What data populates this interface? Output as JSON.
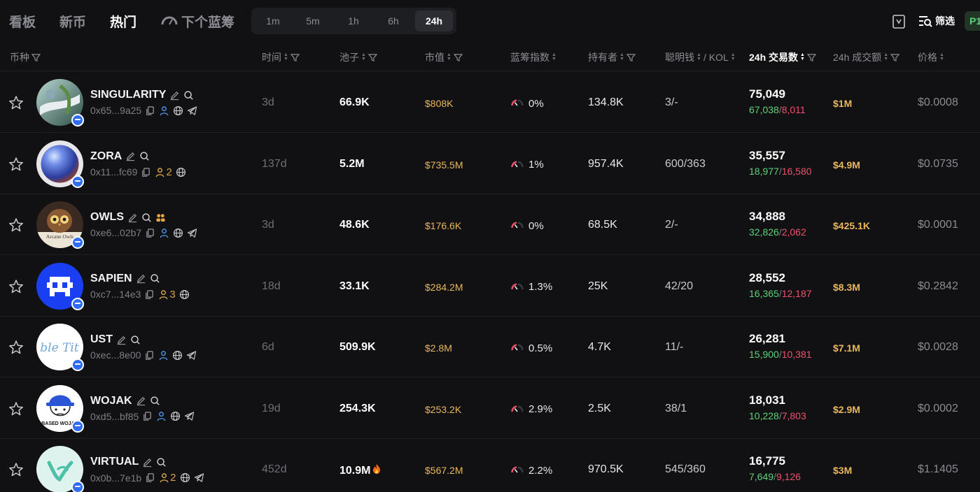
{
  "nav": {
    "tabs": [
      "看板",
      "新币",
      "热门",
      "下个蓝筹"
    ],
    "active_tab": "热门",
    "timeframes": [
      "1m",
      "5m",
      "1h",
      "6h",
      "24h"
    ],
    "active_timeframe": "24h",
    "filter_label": "筛选",
    "page_badge": "P1"
  },
  "headers": {
    "token": "币种",
    "time": "时间",
    "pool": "池子",
    "mcap": "市值",
    "bluechip": "蓝筹指数",
    "holders": "持有者",
    "smart": "聪明钱",
    "kol": "/ KOL",
    "tx": "24h 交易数",
    "volume": "24h 成交额",
    "price": "价格"
  },
  "colors": {
    "buy": "#5fd27a",
    "sell": "#f0506e",
    "accent": "#e9b75c"
  },
  "rows": [
    {
      "name": "SINGULARITY",
      "address": "0x65...9a25",
      "holder_badge": "",
      "icons": [
        "copy-icon",
        "user-icon",
        "globe-icon",
        "telegram-icon"
      ],
      "time": "3d",
      "pool": "66.9K",
      "fire": false,
      "mcap": "$808K",
      "bluechip": "0%",
      "holders": "134.8K",
      "smart": "3/-",
      "tx": "75,049",
      "buys": "67,038",
      "sells": "8,011",
      "volume": "$1M",
      "price": "$0.0008",
      "avatar": "singularity"
    },
    {
      "name": "ZORA",
      "address": "0x11...fc69",
      "holder_badge": "2",
      "icons": [
        "copy-icon",
        "users-icon",
        "globe-icon"
      ],
      "time": "137d",
      "pool": "5.2M",
      "fire": false,
      "mcap": "$735.5M",
      "bluechip": "1%",
      "holders": "957.4K",
      "smart": "600/363",
      "tx": "35,557",
      "buys": "18,977",
      "sells": "16,580",
      "volume": "$4.9M",
      "price": "$0.0735",
      "avatar": "zora"
    },
    {
      "name": "OWLS",
      "address": "0xe6...02b7",
      "holder_badge": "",
      "icons": [
        "copy-icon",
        "user-icon",
        "globe-icon",
        "telegram-icon"
      ],
      "time": "3d",
      "pool": "48.6K",
      "fire": false,
      "mcap": "$176.6K",
      "bluechip": "0%",
      "holders": "68.5K",
      "smart": "2/-",
      "tx": "34,888",
      "buys": "32,826",
      "sells": "2,062",
      "volume": "$425.1K",
      "price": "$0.0001",
      "avatar": "owls",
      "avatar_text": "Arcane Owls"
    },
    {
      "name": "SAPIEN",
      "address": "0xc7...14e3",
      "holder_badge": "3",
      "icons": [
        "copy-icon",
        "users-icon",
        "globe-icon"
      ],
      "time": "18d",
      "pool": "33.1K",
      "fire": false,
      "mcap": "$284.2M",
      "bluechip": "1.3%",
      "holders": "25K",
      "smart": "42/20",
      "tx": "28,552",
      "buys": "16,365",
      "sells": "12,187",
      "volume": "$8.3M",
      "price": "$0.2842",
      "avatar": "sapien"
    },
    {
      "name": "UST",
      "address": "0xec...8e00",
      "holder_badge": "",
      "icons": [
        "copy-icon",
        "user-icon",
        "globe-icon",
        "telegram-icon"
      ],
      "time": "6d",
      "pool": "509.9K",
      "fire": false,
      "mcap": "$2.8M",
      "bluechip": "0.5%",
      "holders": "4.7K",
      "smart": "11/-",
      "tx": "26,281",
      "buys": "15,900",
      "sells": "10,381",
      "volume": "$7.1M",
      "price": "$0.0028",
      "avatar": "ust",
      "avatar_text": "ble Tit"
    },
    {
      "name": "WOJAK",
      "address": "0xd5...bf85",
      "holder_badge": "",
      "icons": [
        "copy-icon",
        "user-icon",
        "globe-icon",
        "telegram-icon"
      ],
      "time": "19d",
      "pool": "254.3K",
      "fire": false,
      "mcap": "$253.2K",
      "bluechip": "2.9%",
      "holders": "2.5K",
      "smart": "38/1",
      "tx": "18,031",
      "buys": "10,228",
      "sells": "7,803",
      "volume": "$2.9M",
      "price": "$0.0002",
      "avatar": "wojak",
      "avatar_text": "BASED WOJAK"
    },
    {
      "name": "VIRTUAL",
      "address": "0x0b...7e1b",
      "holder_badge": "2",
      "icons": [
        "copy-icon",
        "users-icon",
        "globe-icon",
        "telegram-icon"
      ],
      "time": "452d",
      "pool": "10.9M",
      "fire": true,
      "mcap": "$567.2M",
      "bluechip": "2.2%",
      "holders": "970.5K",
      "smart": "545/360",
      "tx": "16,775",
      "buys": "7,649",
      "sells": "9,126",
      "volume": "$3M",
      "price": "$1.1405",
      "avatar": "virtual"
    }
  ]
}
